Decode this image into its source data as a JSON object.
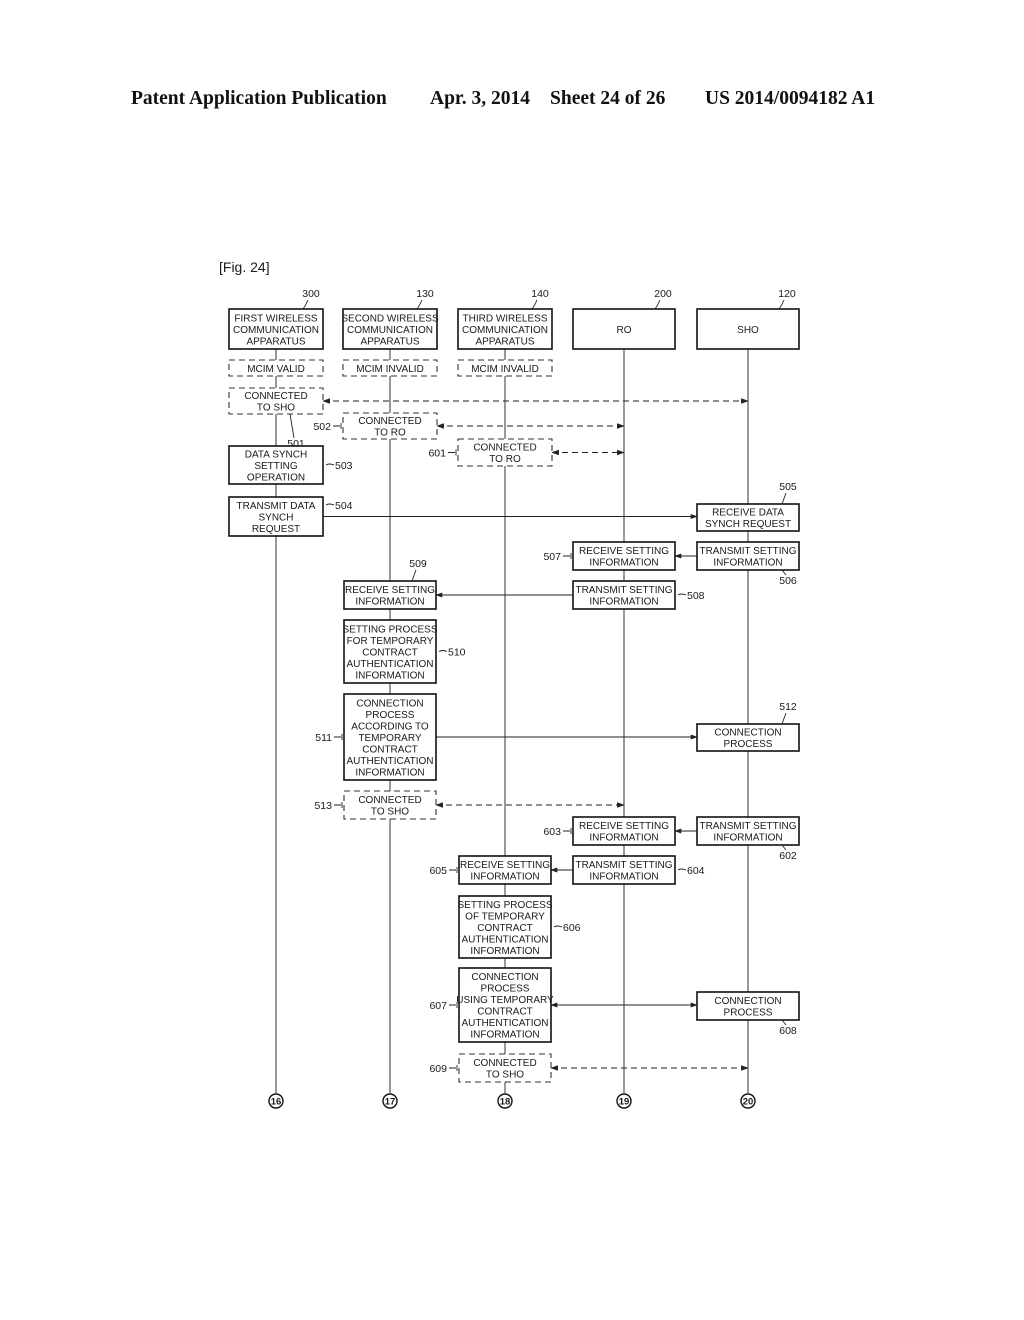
{
  "header": {
    "publication": "Patent Application Publication",
    "date": "Apr. 3, 2014",
    "sheet": "Sheet 24 of 26",
    "number": "US 2014/0094182 A1"
  },
  "figure": {
    "label": "[Fig. 24]",
    "lifelines": [
      {
        "id": "c300",
        "ref": "300",
        "lines": [
          "FIRST WIRELESS",
          "COMMUNICATION",
          "APPARATUS"
        ],
        "connector": "16"
      },
      {
        "id": "c130",
        "ref": "130",
        "lines": [
          "SECOND WIRELESS",
          "COMMUNICATION",
          "APPARATUS"
        ],
        "connector": "17"
      },
      {
        "id": "c140",
        "ref": "140",
        "lines": [
          "THIRD WIRELESS",
          "COMMUNICATION",
          "APPARATUS"
        ],
        "connector": "18"
      },
      {
        "id": "c200",
        "ref": "200",
        "lines": [
          "RO"
        ],
        "connector": "19"
      },
      {
        "id": "c120",
        "ref": "120",
        "lines": [
          "SHO"
        ],
        "connector": "20"
      }
    ],
    "states": [
      {
        "col": "c300",
        "lines": [
          "MCIM VALID"
        ]
      },
      {
        "col": "c130",
        "lines": [
          "MCIM INVALID"
        ]
      },
      {
        "col": "c140",
        "lines": [
          "MCIM INVALID"
        ]
      }
    ],
    "steps": [
      {
        "ref": "501",
        "col": "c300",
        "dashed": true,
        "lines": [
          "CONNECTED",
          "TO SHO"
        ]
      },
      {
        "ref": "502",
        "col": "c130",
        "dashed": true,
        "lines": [
          "CONNECTED",
          "TO RO"
        ]
      },
      {
        "ref": "601",
        "col": "c140",
        "dashed": true,
        "lines": [
          "CONNECTED",
          "TO RO"
        ]
      },
      {
        "ref": "503",
        "col": "c300",
        "dashed": false,
        "lines": [
          "DATA SYNCH",
          "SETTING",
          "OPERATION"
        ]
      },
      {
        "ref": "504",
        "col": "c300",
        "dashed": false,
        "lines": [
          "TRANSMIT DATA",
          "SYNCH",
          "REQUEST"
        ]
      },
      {
        "ref": "505",
        "col": "c120",
        "dashed": false,
        "lines": [
          "RECEIVE DATA",
          "SYNCH REQUEST"
        ]
      },
      {
        "ref": "506",
        "col": "c120",
        "dashed": false,
        "lines": [
          "TRANSMIT SETTING",
          "INFORMATION"
        ]
      },
      {
        "ref": "507",
        "col": "c200",
        "dashed": false,
        "lines": [
          "RECEIVE SETTING",
          "INFORMATION"
        ]
      },
      {
        "ref": "508",
        "col": "c200",
        "dashed": false,
        "lines": [
          "TRANSMIT SETTING",
          "INFORMATION"
        ]
      },
      {
        "ref": "509",
        "col": "c130",
        "dashed": false,
        "lines": [
          "RECEIVE SETTING",
          "INFORMATION"
        ]
      },
      {
        "ref": "510",
        "col": "c130",
        "dashed": false,
        "lines": [
          "SETTING PROCESS",
          "FOR TEMPORARY",
          "CONTRACT",
          "AUTHENTICATION",
          "INFORMATION"
        ]
      },
      {
        "ref": "511",
        "col": "c130",
        "dashed": false,
        "lines": [
          "CONNECTION",
          "PROCESS",
          "ACCORDING TO",
          "TEMPORARY",
          "CONTRACT",
          "AUTHENTICATION",
          "INFORMATION"
        ]
      },
      {
        "ref": "512",
        "col": "c120",
        "dashed": false,
        "lines": [
          "CONNECTION",
          "PROCESS"
        ]
      },
      {
        "ref": "513",
        "col": "c130",
        "dashed": true,
        "lines": [
          "CONNECTED",
          "TO SHO"
        ]
      },
      {
        "ref": "602",
        "col": "c120",
        "dashed": false,
        "lines": [
          "TRANSMIT SETTING",
          "INFORMATION"
        ]
      },
      {
        "ref": "603",
        "col": "c200",
        "dashed": false,
        "lines": [
          "RECEIVE SETTING",
          "INFORMATION"
        ]
      },
      {
        "ref": "604",
        "col": "c200",
        "dashed": false,
        "lines": [
          "TRANSMIT SETTING",
          "INFORMATION"
        ]
      },
      {
        "ref": "605",
        "col": "c140",
        "dashed": false,
        "lines": [
          "RECEIVE SETTING",
          "INFORMATION"
        ]
      },
      {
        "ref": "606",
        "col": "c140",
        "dashed": false,
        "lines": [
          "SETTING PROCESS",
          "OF TEMPORARY",
          "CONTRACT",
          "AUTHENTICATION",
          "INFORMATION"
        ]
      },
      {
        "ref": "607",
        "col": "c140",
        "dashed": false,
        "lines": [
          "CONNECTION",
          "PROCESS",
          "USING TEMPORARY",
          "CONTRACT",
          "AUTHENTICATION",
          "INFORMATION"
        ]
      },
      {
        "ref": "608",
        "col": "c120",
        "dashed": false,
        "lines": [
          "CONNECTION",
          "PROCESS"
        ]
      },
      {
        "ref": "609",
        "col": "c140",
        "dashed": true,
        "lines": [
          "CONNECTED",
          "TO SHO"
        ]
      }
    ],
    "messages": [
      {
        "from": "501",
        "to": "c120",
        "style": "dashed",
        "direction": "both"
      },
      {
        "from": "502",
        "to": "c200",
        "style": "dashed",
        "direction": "both"
      },
      {
        "from": "601",
        "to": "c200",
        "style": "dashed",
        "direction": "both"
      },
      {
        "from": "504",
        "to": "505",
        "style": "solid",
        "direction": "forward"
      },
      {
        "from": "506",
        "to": "507",
        "style": "solid",
        "direction": "forward"
      },
      {
        "from": "508",
        "to": "509",
        "style": "solid",
        "direction": "forward"
      },
      {
        "from": "511",
        "to": "512",
        "style": "solid",
        "direction": "forward"
      },
      {
        "from": "513",
        "to": "c200",
        "style": "dashed",
        "direction": "both"
      },
      {
        "from": "602",
        "to": "603",
        "style": "solid",
        "direction": "forward"
      },
      {
        "from": "604",
        "to": "605",
        "style": "solid",
        "direction": "forward"
      },
      {
        "from": "607",
        "to": "608",
        "style": "solid",
        "direction": "both"
      },
      {
        "from": "609",
        "to": "c120",
        "style": "dashed",
        "direction": "both"
      }
    ]
  }
}
